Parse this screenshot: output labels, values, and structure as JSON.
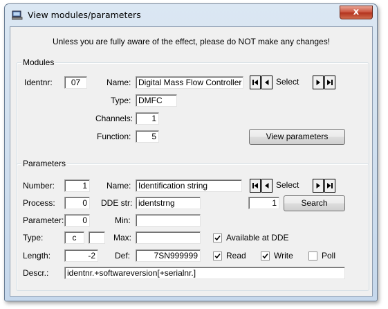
{
  "window": {
    "title": "View modules/parameters",
    "close_glyph": "x"
  },
  "warning": "Unless you are fully aware of the effect, please do NOT make any changes!",
  "modules": {
    "group_title": "Modules",
    "identnr_label": "Identnr:",
    "identnr_value": "07",
    "name_label": "Name:",
    "name_value": "Digital Mass Flow Controller",
    "type_label": "Type:",
    "type_value": "DMFC",
    "channels_label": "Channels:",
    "channels_value": "1",
    "function_label": "Function:",
    "function_value": "5",
    "nav_select": "Select",
    "view_params_label": "View parameters"
  },
  "parameters": {
    "group_title": "Parameters",
    "number_label": "Number:",
    "number_value": "1",
    "name_label": "Name:",
    "name_value": "Identification string",
    "process_label": "Process:",
    "process_value": "0",
    "dde_label": "DDE str:",
    "dde_value": "identstrng",
    "parameter_label": "Parameter:",
    "parameter_value": "0",
    "min_label": "Min:",
    "min_value": "",
    "type_label": "Type:",
    "type_value": "c",
    "type_value2": "",
    "max_label": "Max:",
    "max_value": "",
    "length_label": "Length:",
    "length_value": "-2",
    "def_label": "Def:",
    "def_value": "7SN999999",
    "descr_label": "Descr.:",
    "descr_value": "identnr.+softwareversion[+serialnr.]",
    "nav_select": "Select",
    "search_value": "1",
    "search_label": "Search",
    "available_dde_label": "Available at DDE",
    "available_dde_checked": true,
    "read_label": "Read",
    "read_checked": true,
    "write_label": "Write",
    "write_checked": true,
    "poll_label": "Poll",
    "poll_checked": false
  }
}
